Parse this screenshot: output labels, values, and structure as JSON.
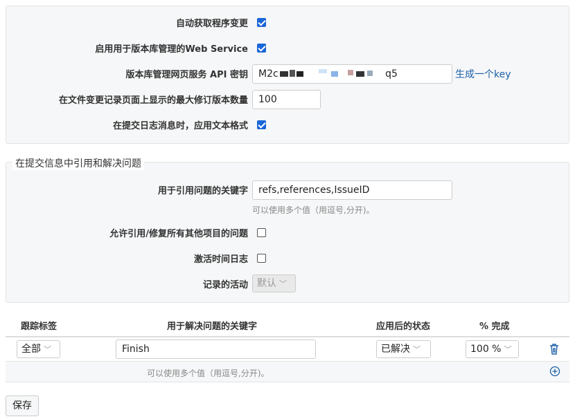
{
  "settings": {
    "auto_fetch": {
      "label": "自动获取程序变更",
      "checked": true
    },
    "enable_ws": {
      "label": "启用用于版本库管理的Web Service",
      "checked": true
    },
    "api_key": {
      "label": "版本库管理网页服务 API 密钥",
      "value_start": "M2c",
      "value_end": "q5",
      "generate_link": "生成一个key"
    },
    "max_revisions": {
      "label": "在文件变更记录页面上显示的最大修订版本数量",
      "value": "100"
    },
    "text_format": {
      "label": "在提交日志消息时，应用文本格式",
      "checked": true
    }
  },
  "references": {
    "legend": "在提交信息中引用和解决问题",
    "keywords": {
      "label": "用于引用问题的关键字",
      "value": "refs,references,IssueID",
      "hint": "可以使用多个值（用逗号,分开)。"
    },
    "cross_project": {
      "label": "允许引用/修复所有其他项目的问题",
      "checked": false
    },
    "time_log": {
      "label": "激活时间日志",
      "checked": false
    },
    "activity": {
      "label": "记录的活动",
      "value": "默认"
    }
  },
  "fix_table": {
    "headers": [
      "跟踪标签",
      "用于解决问题的关键字",
      "应用后的状态",
      "% 完成"
    ],
    "row": {
      "tracker": "全部",
      "keyword": "Finish",
      "status": "已解决",
      "done": "100 %"
    },
    "hint": "可以使用多个值（用逗号,分开)。"
  },
  "save_label": "保存",
  "colors": {
    "accent": "#1b66d8",
    "link": "#1a5fa8",
    "panel": "#f6f7f8"
  },
  "icons": [
    "checkbox-checked-icon",
    "trash-icon",
    "plus-circle-icon",
    "chevron-down-icon"
  ]
}
